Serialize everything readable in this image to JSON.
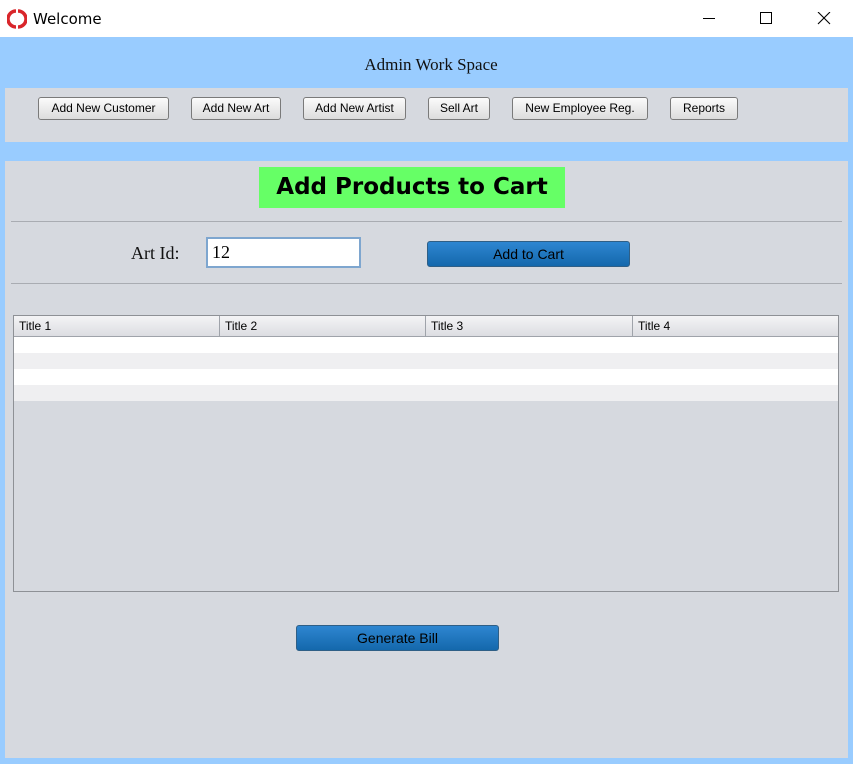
{
  "window": {
    "title": "Welcome"
  },
  "workspace": {
    "title": "Admin Work Space"
  },
  "nav": {
    "buttons": [
      "Add New Customer",
      "Add New Art",
      "Add New Artist",
      "Sell Art",
      "New Employee Reg.",
      "Reports"
    ]
  },
  "cart": {
    "heading": "Add Products to Cart",
    "art_id_label": "Art Id:",
    "art_id_value": "12",
    "add_button": "Add to Cart",
    "table": {
      "columns": [
        "Title 1",
        "Title 2",
        "Title 3",
        "Title 4"
      ],
      "rows": [
        [
          "",
          "",
          "",
          ""
        ],
        [
          "",
          "",
          "",
          ""
        ],
        [
          "",
          "",
          "",
          ""
        ],
        [
          "",
          "",
          "",
          ""
        ]
      ]
    },
    "generate_button": "Generate Bill"
  },
  "colors": {
    "background": "#99ccff",
    "panel": "#d6d9df",
    "heading_bg": "#66ff66",
    "button_blue": "#1f77c0"
  }
}
